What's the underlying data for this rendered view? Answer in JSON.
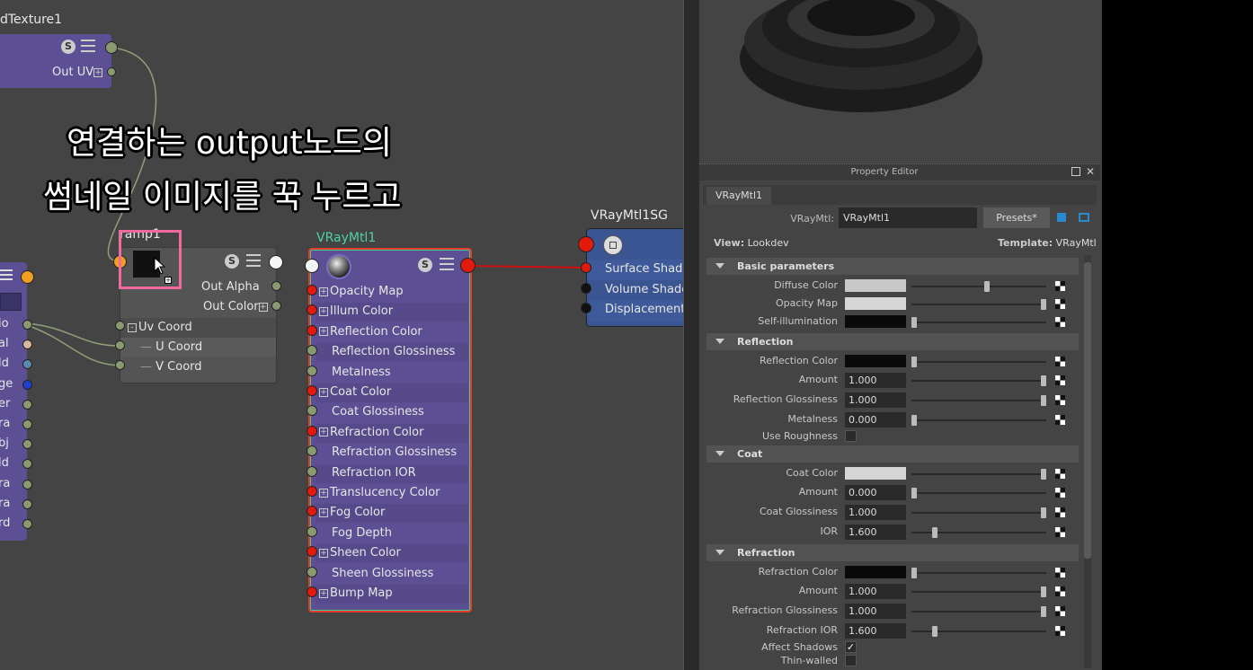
{
  "annotation": {
    "line1": "연결하는 output노드의",
    "line2": "썸네일 이미지를 꾹 누르고"
  },
  "place2d_node": {
    "title": "dTexture1",
    "out_uv": "Out UV"
  },
  "left_node": {
    "port_labels": [
      "io",
      "al",
      "ld",
      "ge",
      "er",
      "ra",
      "bj",
      "ld",
      "ra",
      "ra",
      "rd"
    ]
  },
  "ramp_node": {
    "title": "ramp1",
    "rows": {
      "out_alpha": "Out Alpha",
      "out_color": "Out Color",
      "uv_coord": "Uv Coord",
      "u_coord": "U Coord",
      "v_coord": "V Coord"
    }
  },
  "vray_node": {
    "title": "VRayMtl1",
    "rows": [
      "Opacity Map",
      "Illum Color",
      "Reflection Color",
      "Reflection Glossiness",
      "Metalness",
      "Coat Color",
      "Coat Glossiness",
      "Refraction Color",
      "Refraction Glossiness",
      "Refraction IOR",
      "Translucency Color",
      "Fog Color",
      "Fog Depth",
      "Sheen Color",
      "Sheen Glossiness",
      "Bump Map"
    ]
  },
  "sg_node": {
    "title": "VRayMtl1SG",
    "rows": [
      "Surface Shader",
      "Volume Shader",
      "Displacement"
    ]
  },
  "property_editor": {
    "title": "Property Editor",
    "tab": "VRayMtl1",
    "type_label": "VRayMtl:",
    "name_value": "VRayMtl1",
    "presets": "Presets*",
    "view_label": "View:",
    "view_value": "Lookdev",
    "template_label": "Template:",
    "template_value": "VRayMtl",
    "sections": {
      "basic": "Basic parameters",
      "reflection": "Reflection",
      "coat": "Coat",
      "refraction": "Refraction"
    },
    "basic": {
      "diffuse_color": "Diffuse Color",
      "opacity_map": "Opacity Map",
      "self_illum": "Self-illumination"
    },
    "reflection": {
      "refl_color": "Reflection Color",
      "amount": "Amount",
      "amount_val": "1.000",
      "refl_gloss": "Reflection Glossiness",
      "refl_gloss_val": "1.000",
      "metalness": "Metalness",
      "metalness_val": "0.000",
      "use_roughness": "Use Roughness"
    },
    "coat": {
      "coat_color": "Coat Color",
      "amount": "Amount",
      "amount_val": "0.000",
      "coat_gloss": "Coat Glossiness",
      "coat_gloss_val": "1.000",
      "ior": "IOR",
      "ior_val": "1.600"
    },
    "refraction": {
      "refr_color": "Refraction Color",
      "amount": "Amount",
      "amount_val": "1.000",
      "refr_gloss": "Refraction Glossiness",
      "refr_gloss_val": "1.000",
      "refr_ior": "Refraction IOR",
      "refr_ior_val": "1.600",
      "affect_shadows": "Affect Shadows",
      "thin_walled": "Thin-walled"
    },
    "colors": {
      "diffuse": "#c8c8c8",
      "opacity": "#d6d6d6",
      "self_illum": "#0a0a0a",
      "refl": "#0a0a0a",
      "coat": "#d6d6d6",
      "refr": "#0a0a0a"
    }
  }
}
